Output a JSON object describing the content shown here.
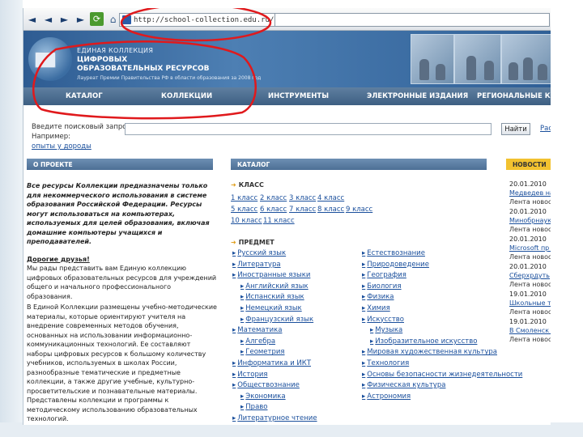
{
  "browser": {
    "url": "http://school-collection.edu.ru/",
    "buttons": {
      "back": "◄",
      "forward": "►",
      "next": "►",
      "refresh": "⟳",
      "home": "⌂",
      "tools": "✎"
    }
  },
  "header": {
    "line1": "ЕДИНАЯ КОЛЛЕКЦИЯ",
    "line2": "ЦИФРОВЫХ",
    "line3": "ОБРАЗОВАТЕЛЬНЫХ РЕСУРСОВ",
    "line4": "Лауреат Премии Правительства РФ в области образования за 2008 год"
  },
  "nav": [
    {
      "label": "КАТАЛОГ"
    },
    {
      "label": "КОЛЛЕКЦИИ"
    },
    {
      "label": "ИНСТРУМЕНТЫ"
    },
    {
      "label": "ЭЛЕКТРОННЫЕ ИЗДАНИЯ"
    },
    {
      "label": "РЕГИОНАЛЬНЫЕ КОЛЛЕК"
    }
  ],
  "search": {
    "label": "Введите поисковый запрос:",
    "example_label": "Например:",
    "example_link": "опыты у дороды",
    "button": "Найти",
    "advanced": "Рас"
  },
  "sections": {
    "about": "О ПРОЕКТЕ",
    "catalog": "КАТАЛОГ",
    "news": "НОВОСТИ"
  },
  "about": {
    "notice": "Все ресурсы Коллекции предназначены только для некоммерческого использования в системе образования Российской Федерации. Ресурсы могут использоваться на компьютерах, используемых для целей образования, включая домашние компьютеры учащихся и преподавателей.",
    "greeting": "Дорогие друзья!",
    "para1": "Мы рады представить вам Единую коллекцию цифровых образовательных ресурсов для учреждений общего и начального профессионального образования.",
    "para2": "В Единой Коллекции размещены учебно-методические материалы, которые ориентируют учителя на внедрение современных методов обучения, основанных на использовании информационно-коммуникационных технологий. Ее составляют наборы цифровых ресурсов к большому количеству учебников, используемых в школах России, разнообразные тематические и предметные коллекции, а также другие учебные, культурно-просветительские и познавательные материалы. Представлены коллекции и программы к методическому использованию образовательных технологий."
  },
  "catalog": {
    "class_head": "КЛАСС",
    "classes": [
      "1 класс",
      "2 класс",
      "3 класс",
      "4 класс",
      "5 класс",
      "6 класс",
      "7 класс",
      "8 класс",
      "9 класс",
      "10 класс",
      "11 класс"
    ],
    "subject_head": "ПРЕДМЕТ",
    "subjects_left": [
      {
        "label": "Русский язык",
        "sub": false
      },
      {
        "label": "Литература",
        "sub": false
      },
      {
        "label": "Иностранные языки",
        "sub": false
      },
      {
        "label": "Английский язык",
        "sub": true
      },
      {
        "label": "Испанский язык",
        "sub": true
      },
      {
        "label": "Немецкий язык",
        "sub": true
      },
      {
        "label": "Французский язык",
        "sub": true
      },
      {
        "label": "Математика",
        "sub": false
      },
      {
        "label": "Алгебра",
        "sub": true
      },
      {
        "label": "Геометрия",
        "sub": true
      },
      {
        "label": "Информатика и ИКТ",
        "sub": false
      },
      {
        "label": "История",
        "sub": false
      },
      {
        "label": "Обществознание",
        "sub": false
      },
      {
        "label": "Экономика",
        "sub": true
      },
      {
        "label": "Право",
        "sub": true
      },
      {
        "label": "Литературное чтение",
        "sub": false
      }
    ],
    "subjects_right": [
      {
        "label": "Естествознание",
        "sub": false
      },
      {
        "label": "Природоведение",
        "sub": false
      },
      {
        "label": "География",
        "sub": false
      },
      {
        "label": "Биология",
        "sub": false
      },
      {
        "label": "Физика",
        "sub": false
      },
      {
        "label": "Химия",
        "sub": false
      },
      {
        "label": "Искусство",
        "sub": false
      },
      {
        "label": "Музыка",
        "sub": true
      },
      {
        "label": "Изобразительное искусство",
        "sub": true
      },
      {
        "label": "Мировая художественная культура",
        "sub": false
      },
      {
        "label": "Технология",
        "sub": false
      },
      {
        "label": "Основы безопасности жизнедеятельности",
        "sub": false
      },
      {
        "label": "Физическая культура",
        "sub": false
      },
      {
        "label": "Астрономия",
        "sub": false
      }
    ]
  },
  "news": [
    {
      "date": "20.01.2010",
      "title": "Медведев на информацио",
      "src": "Лента новос"
    },
    {
      "date": "20.01.2010",
      "title": "Минобрнаук проект \"Со",
      "src": "Лента новос"
    },
    {
      "date": "20.01.2010",
      "title": "Microsoft пр лиде-моро",
      "src": "Лента новос"
    },
    {
      "date": "20.01.2010",
      "title": "Сберхрдуть",
      "src": "Лента новос"
    },
    {
      "date": "19.01.2010",
      "title": "Школьные т принятие",
      "src": "Лента новос"
    },
    {
      "date": "19.01.2010",
      "title": "В Смоленск задачи кор",
      "src": "Лента новос"
    }
  ],
  "colors": {
    "header_blue": "#3d6fa5",
    "nav_blue": "#4a6c91",
    "news_yellow": "#f2c230",
    "link": "#1a4f9c",
    "annotation_red": "#e0191c"
  }
}
